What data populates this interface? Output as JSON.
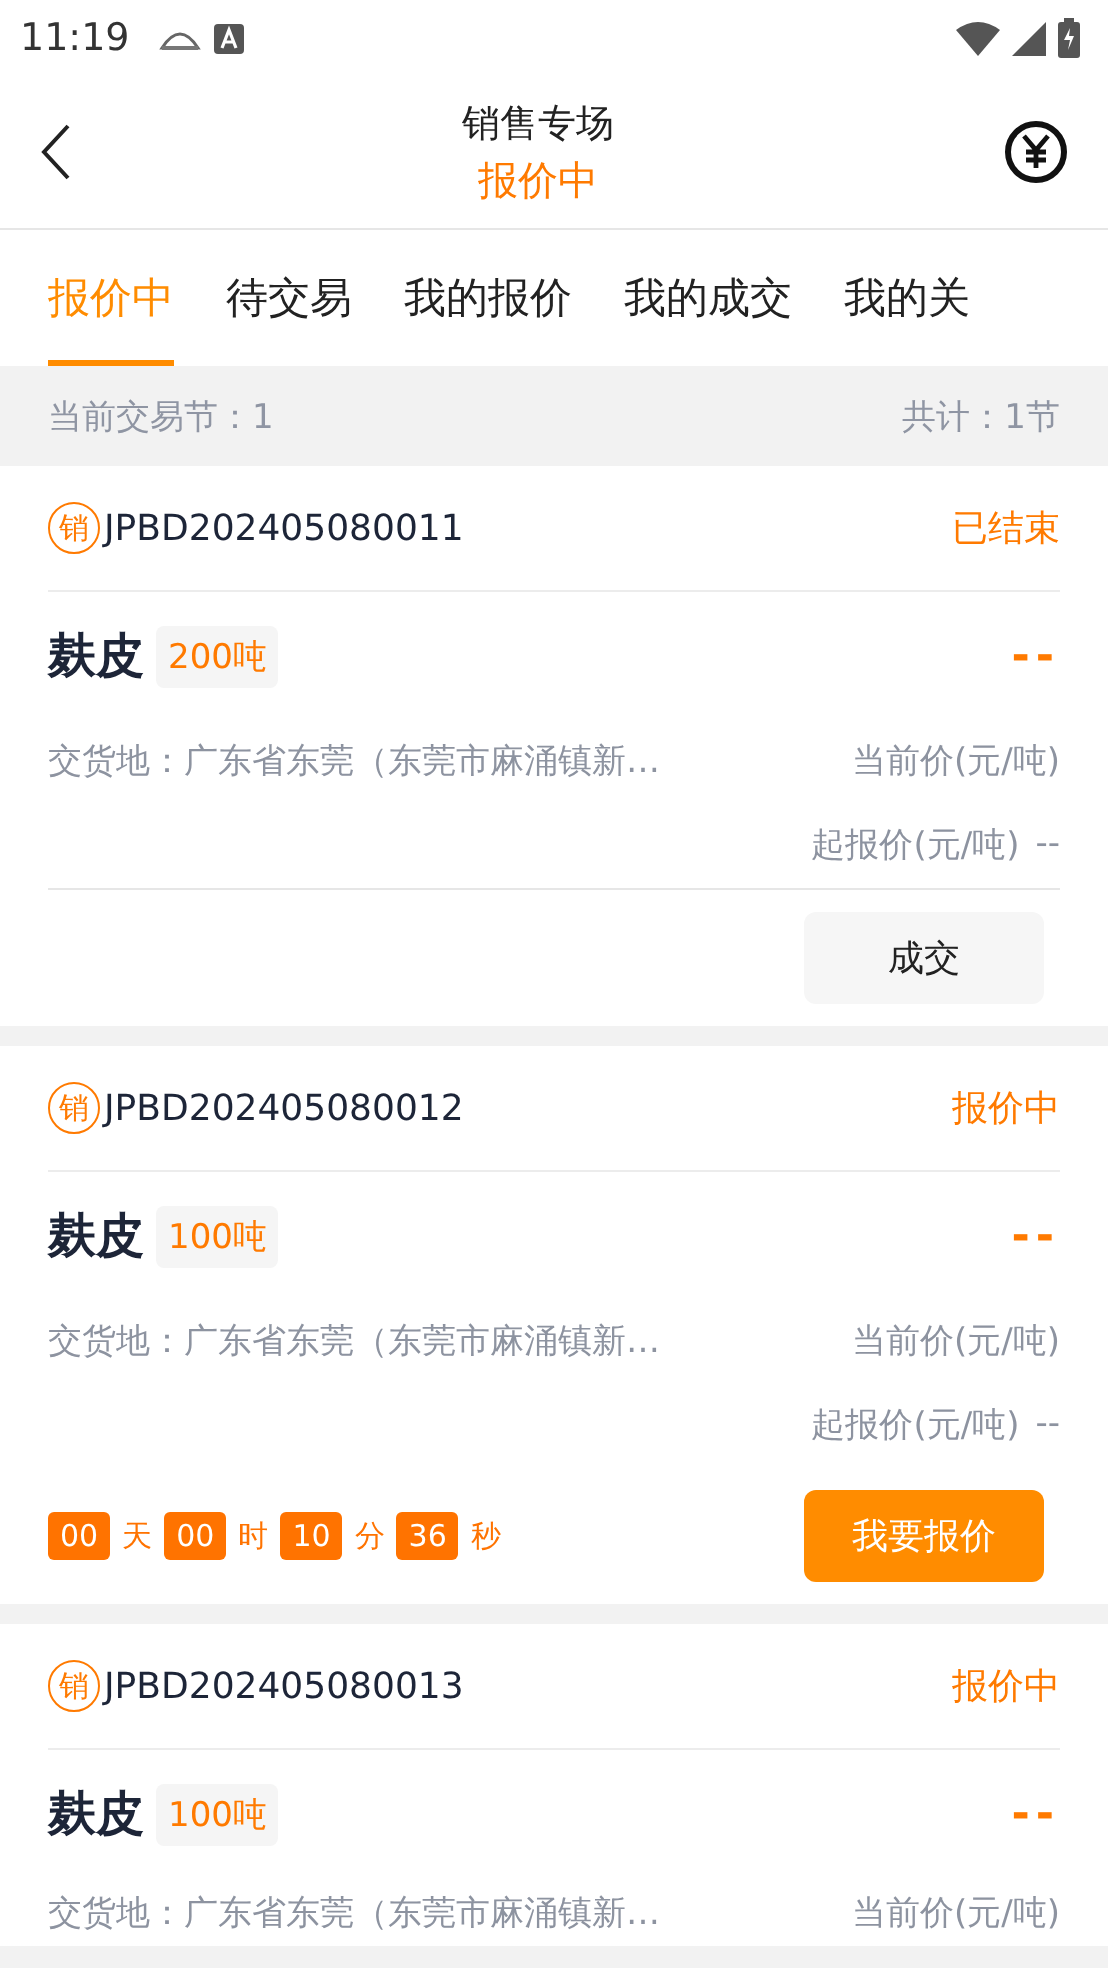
{
  "status_bar": {
    "time": "11:19"
  },
  "header": {
    "title": "销售专场",
    "subtitle": "报价中"
  },
  "tabs": [
    {
      "label": "报价中",
      "selected": true
    },
    {
      "label": "待交易",
      "selected": false
    },
    {
      "label": "我的报价",
      "selected": false
    },
    {
      "label": "我的成交",
      "selected": false
    },
    {
      "label": "我的关",
      "selected": false
    }
  ],
  "info_bar": {
    "session": "当前交易节：1",
    "total": "共计：1节"
  },
  "cards": [
    {
      "badge": "销",
      "id": "JPBD202405080011",
      "status": "已结束",
      "product": "麸皮",
      "quantity": "200吨",
      "price": "--",
      "location": "交货地：广东省东莞（东莞市麻涌镇新…",
      "current_price_label": "当前价(元/吨)",
      "start_price_label": "起报价(元/吨)",
      "start_price": "--",
      "action": {
        "kind": "plain",
        "label": "成交"
      }
    },
    {
      "badge": "销",
      "id": "JPBD202405080012",
      "status": "报价中",
      "product": "麸皮",
      "quantity": "100吨",
      "price": "--",
      "location": "交货地：广东省东莞（东莞市麻涌镇新…",
      "current_price_label": "当前价(元/吨)",
      "start_price_label": "起报价(元/吨)",
      "start_price": "--",
      "countdown": [
        {
          "value": "00",
          "unit": "天"
        },
        {
          "value": "00",
          "unit": "时"
        },
        {
          "value": "10",
          "unit": "分"
        },
        {
          "value": "36",
          "unit": "秒"
        }
      ],
      "action": {
        "kind": "primary",
        "label": "我要报价"
      }
    },
    {
      "badge": "销",
      "id": "JPBD202405080013",
      "status": "报价中",
      "product": "麸皮",
      "quantity": "100吨",
      "price": "--",
      "location": "交货地：广东省东莞（东莞市麻涌镇新…",
      "current_price_label": "当前价(元/吨)"
    }
  ]
}
